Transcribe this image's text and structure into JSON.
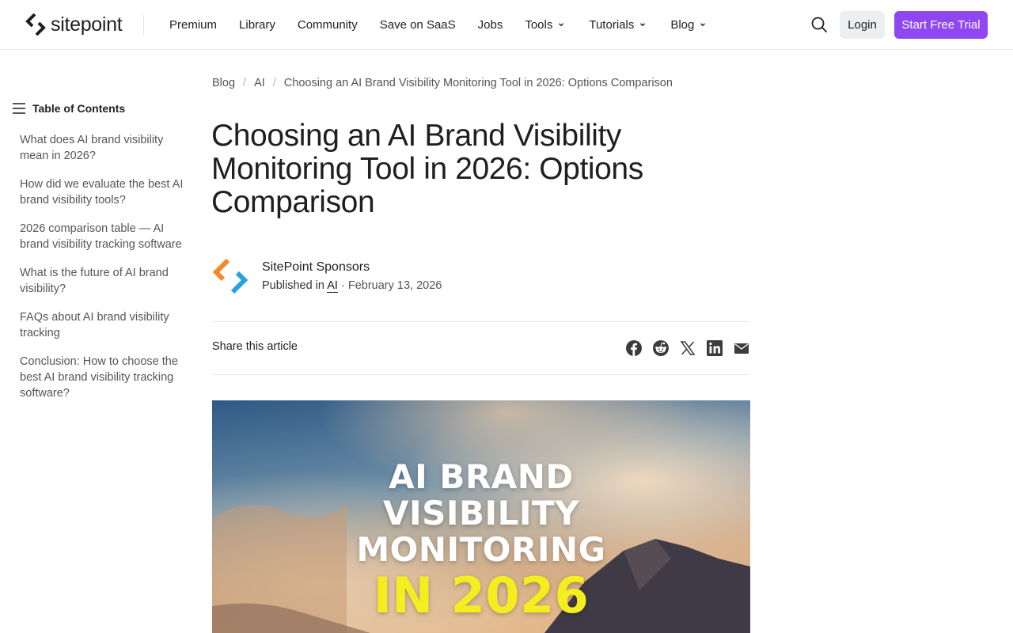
{
  "header": {
    "logo_text": "sitepoint",
    "nav": [
      {
        "label": "Premium",
        "dropdown": false
      },
      {
        "label": "Library",
        "dropdown": false
      },
      {
        "label": "Community",
        "dropdown": false
      },
      {
        "label": "Save on SaaS",
        "dropdown": false
      },
      {
        "label": "Jobs",
        "dropdown": false
      },
      {
        "label": "Tools",
        "dropdown": true
      },
      {
        "label": "Tutorials",
        "dropdown": true
      },
      {
        "label": "Blog",
        "dropdown": true
      }
    ],
    "login_label": "Login",
    "trial_label": "Start Free Trial",
    "accent_color": "#8f47f0"
  },
  "toc": {
    "title": "Table of Contents",
    "items": [
      "What does AI brand visibility mean in 2026?",
      "How did we evaluate the best AI brand visibility tools?",
      "2026 comparison table — AI brand visibility tracking software",
      "What is the future of AI brand visibility?",
      "FAQs about AI brand visibility tracking",
      "Conclusion: How to choose the best AI brand visibility tracking software?"
    ]
  },
  "breadcrumb": [
    "Blog",
    "AI",
    "Choosing an AI Brand Visibility Monitoring Tool in 2026: Options Comparison"
  ],
  "article": {
    "title": "Choosing an AI Brand Visibility Monitoring Tool in 2026: Options Comparison",
    "author": "SitePoint Sponsors",
    "published_prefix": "Published in",
    "category": "AI",
    "date_sep": "·",
    "date": "February 13, 2026",
    "share_label": "Share this article",
    "share_icons": [
      "facebook-icon",
      "reddit-icon",
      "x-icon",
      "linkedin-icon",
      "email-icon"
    ]
  },
  "hero": {
    "lines": [
      "AI BRAND",
      "VISIBILITY",
      "MONITORING",
      "IN 2026"
    ],
    "highlight_color": "#f5ee1e"
  }
}
